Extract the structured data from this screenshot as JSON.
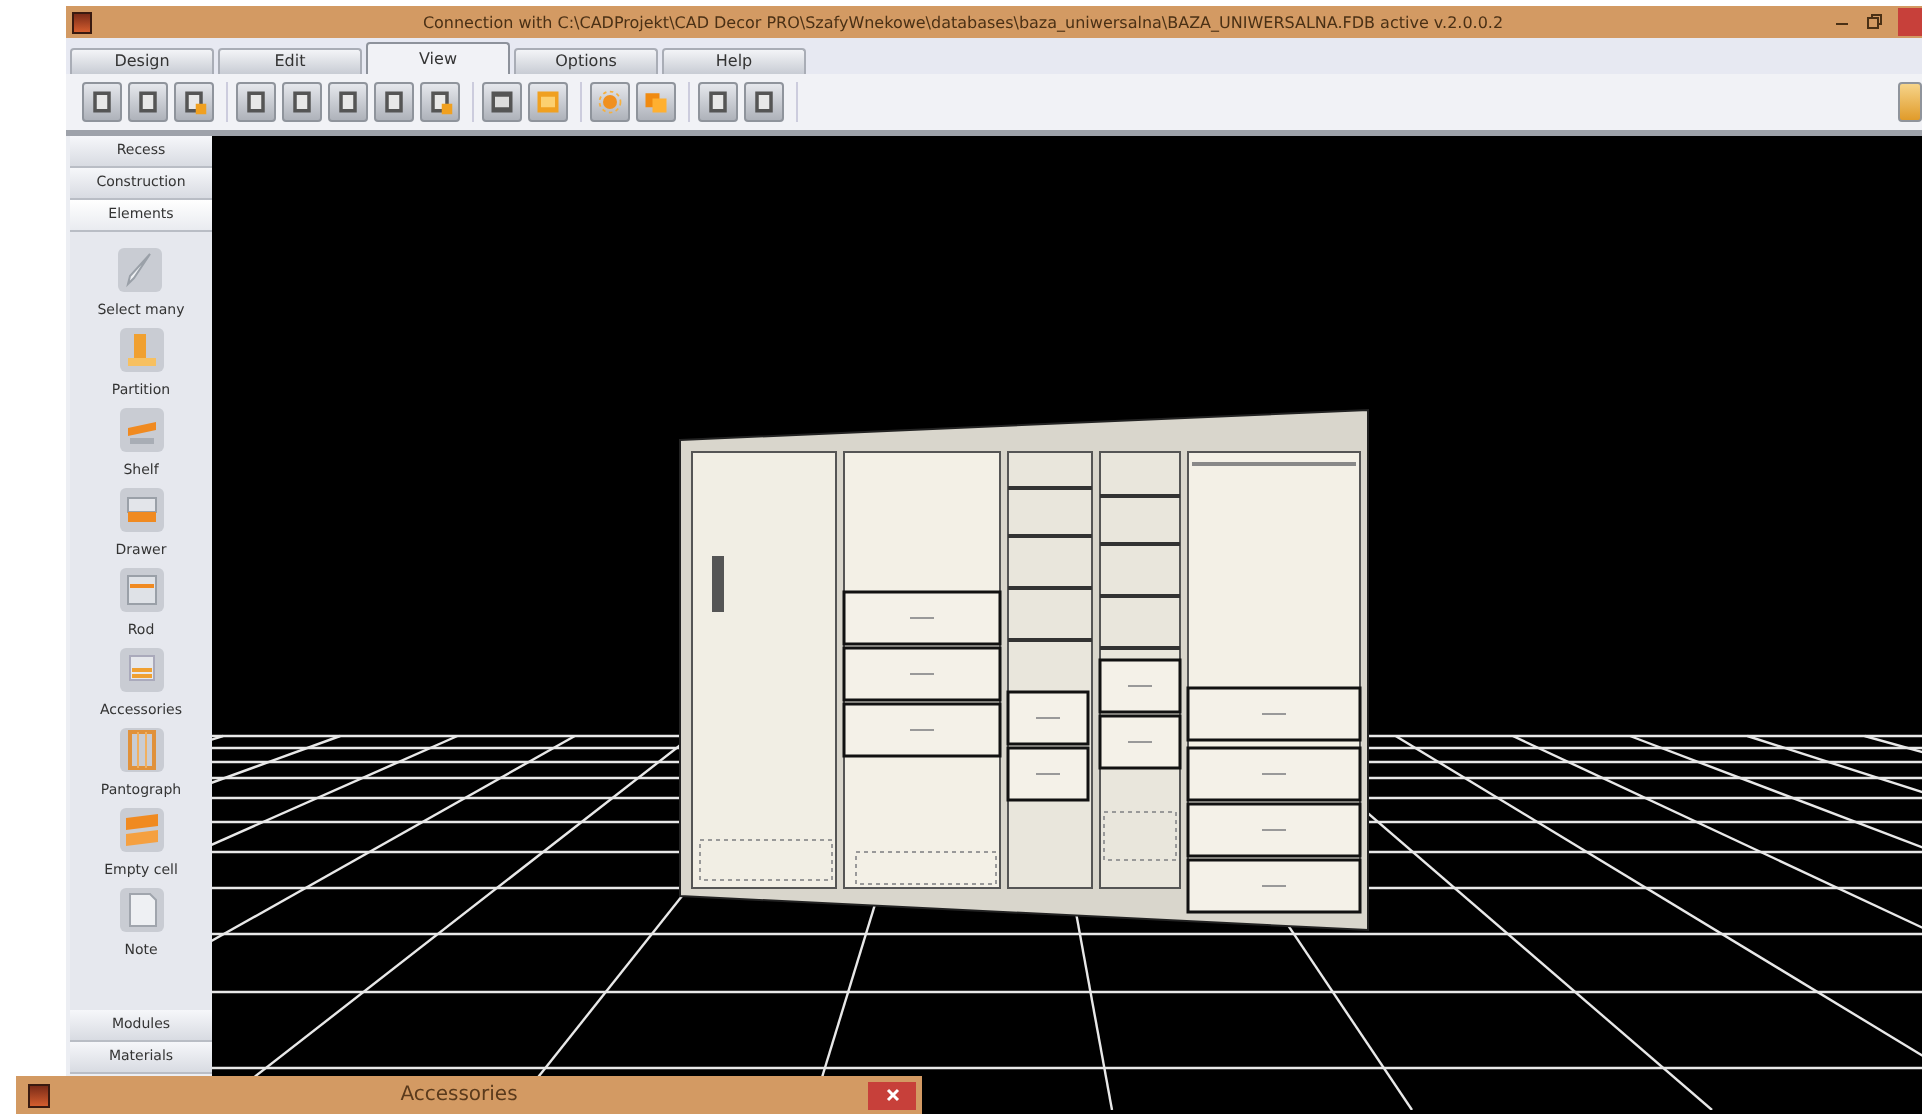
{
  "window": {
    "title": "Connection with C:\\CADProjekt\\CAD Decor PRO\\SzafyWnekowe\\databases\\baza_uniwersalna\\BAZA_UNIWERSALNA.FDB active  v.2.0.0.2"
  },
  "tabs": [
    {
      "label": "Design",
      "selected": false
    },
    {
      "label": "Edit",
      "selected": false
    },
    {
      "label": "View",
      "selected": true
    },
    {
      "label": "Options",
      "selected": false
    },
    {
      "label": "Help",
      "selected": false
    }
  ],
  "sidebar": {
    "sections_top": [
      {
        "label": "Recess",
        "selected": false
      },
      {
        "label": "Construction",
        "selected": false
      },
      {
        "label": "Elements",
        "selected": true
      }
    ],
    "tools": [
      {
        "label": "Select many"
      },
      {
        "label": "Partition"
      },
      {
        "label": "Shelf"
      },
      {
        "label": "Drawer"
      },
      {
        "label": "Rod"
      },
      {
        "label": "Accessories"
      },
      {
        "label": "Pantograph"
      },
      {
        "label": "Empty cell"
      },
      {
        "label": "Note"
      }
    ],
    "sections_bottom": [
      {
        "label": "Modules",
        "selected": false
      },
      {
        "label": "Materials",
        "selected": false
      }
    ]
  },
  "dialog": {
    "title": "Accessories"
  }
}
